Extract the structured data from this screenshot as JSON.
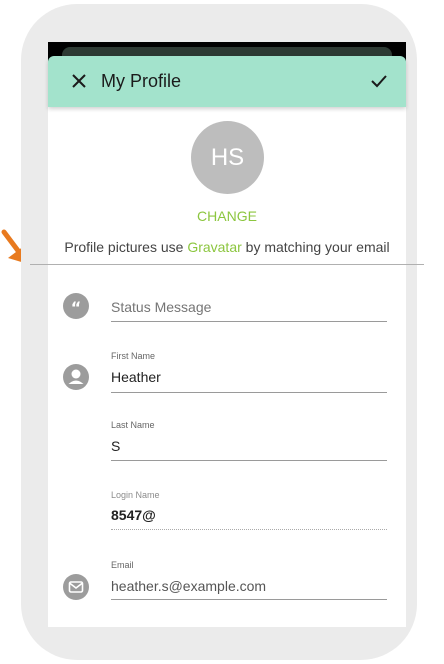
{
  "header": {
    "title": "My Profile",
    "close_icon": "close-icon",
    "confirm_icon": "checkmark-icon",
    "color": "#a3e3cc"
  },
  "avatar": {
    "initials": "HS",
    "change_label": "CHANGE"
  },
  "gravatar_note": {
    "prefix": "Profile pictures use ",
    "link": "Gravatar",
    "suffix": " by matching your email"
  },
  "form": {
    "status": {
      "placeholder": "Status Message",
      "icon": "quote-icon"
    },
    "first_name": {
      "label": "First Name",
      "value": "Heather",
      "icon": "person-icon"
    },
    "last_name": {
      "label": "Last Name",
      "value": "S"
    },
    "login_name": {
      "label": "Login Name",
      "value": "8547@"
    },
    "email": {
      "label": "Email",
      "value": "heather.s@example.com",
      "icon": "mail-icon"
    }
  },
  "colors": {
    "accent": "#8cc63f",
    "arrow": "#e87a1f",
    "icon_gray": "#9c9c9c"
  }
}
